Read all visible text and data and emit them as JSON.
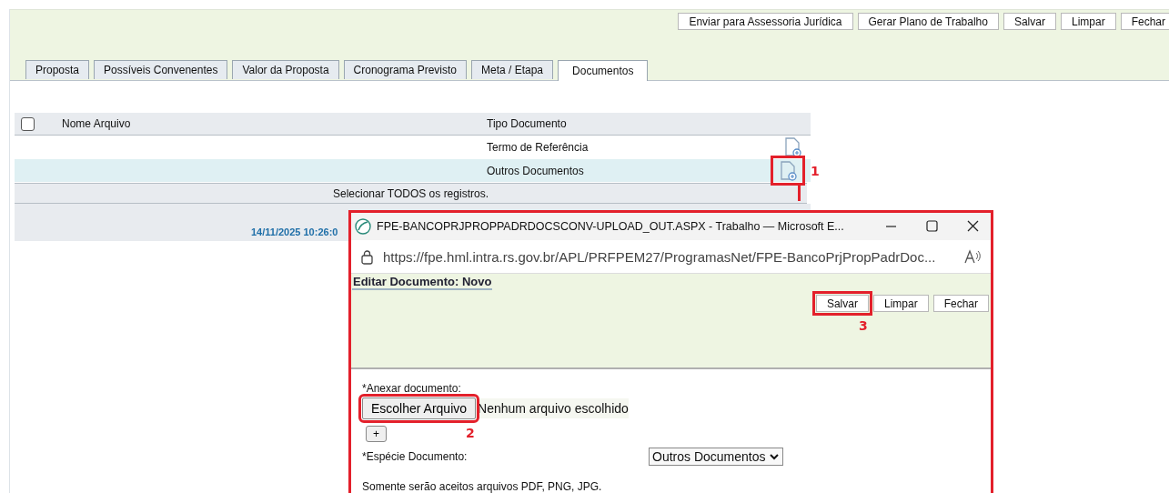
{
  "toolbar": {
    "buttons": [
      {
        "label": "Enviar para Assessoria Jurídica"
      },
      {
        "label": "Gerar Plano de Trabalho"
      },
      {
        "label": "Salvar"
      },
      {
        "label": "Limpar"
      },
      {
        "label": "Fechar"
      }
    ]
  },
  "tabs": [
    {
      "label": "Proposta",
      "selected": false
    },
    {
      "label": "Possíveis Convenentes",
      "selected": false
    },
    {
      "label": "Valor da Proposta",
      "selected": false
    },
    {
      "label": "Cronograma Previsto",
      "selected": false
    },
    {
      "label": "Meta / Etapa",
      "selected": false
    },
    {
      "label": "Documentos",
      "selected": true
    }
  ],
  "table": {
    "header_checked": false,
    "columns": [
      "Nome Arquivo",
      "Tipo Documento"
    ],
    "rows": [
      {
        "tipo_documento": "Termo de Referência",
        "selected": false
      },
      {
        "tipo_documento": "Outros Documentos",
        "selected": true,
        "callout": "1"
      }
    ],
    "select_all": "Selecionar TODOS os registros.",
    "timestamp": "14/11/2025 10:26:0"
  },
  "popup": {
    "title": "FPE-BANCOPRJPROPPADRDOCSCONV-UPLOAD_OUT.ASPX - Trabalho — Microsoft E...",
    "url": "https://fpe.hml.intra.rs.gov.br/APL/PRFPEM27/ProgramasNet/FPE-BancoPrjPropPadrDoc...",
    "heading": "Editar Documento: Novo",
    "buttons": [
      {
        "label": "Salvar",
        "callout": "3"
      },
      {
        "label": "Limpar"
      },
      {
        "label": "Fechar"
      }
    ],
    "attach_label": "*Anexar documento:",
    "file_button": {
      "label": "Escolher Arquivo",
      "callout": "2"
    },
    "file_status": "Nenhum arquivo escolhido",
    "add_button": "+",
    "species_label": "*Espécie Documento:",
    "species_value": "Outros Documentos",
    "note": "Somente serão aceitos arquivos PDF, PNG, JPG."
  }
}
